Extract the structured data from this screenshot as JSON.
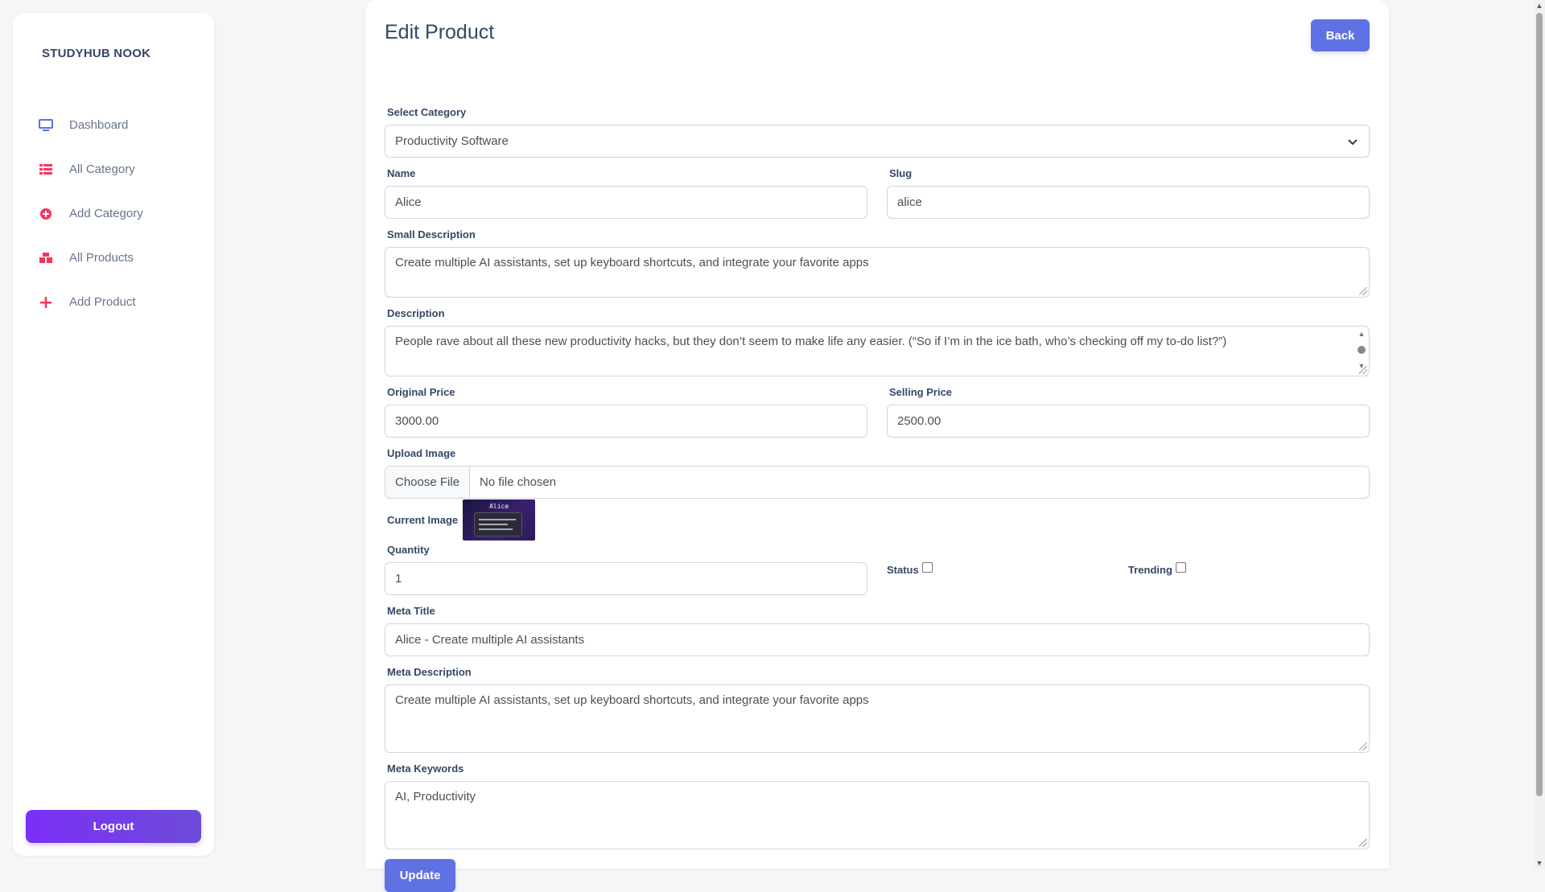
{
  "sidebar": {
    "brand": "STUDYHUB NOOK",
    "items": [
      {
        "label": "Dashboard",
        "icon": "monitor-icon"
      },
      {
        "label": "All Category",
        "icon": "list-icon"
      },
      {
        "label": "Add Category",
        "icon": "plus-circle-icon"
      },
      {
        "label": "All Products",
        "icon": "boxes-icon"
      },
      {
        "label": "Add Product",
        "icon": "plus-icon"
      }
    ],
    "logout": "Logout"
  },
  "header": {
    "title": "Edit Product",
    "back": "Back"
  },
  "form": {
    "category": {
      "label": "Select Category",
      "value": "Productivity Software"
    },
    "name": {
      "label": "Name",
      "value": "Alice"
    },
    "slug": {
      "label": "Slug",
      "value": "alice"
    },
    "small_description": {
      "label": "Small Description",
      "value": "Create multiple AI assistants, set up keyboard shortcuts, and integrate your favorite apps"
    },
    "description": {
      "label": "Description",
      "value": "People rave about all these new productivity hacks, but they don’t seem to make life any easier. (“So if I’m in the ice bath, who’s checking off my to-do list?”)"
    },
    "original_price": {
      "label": "Original Price",
      "value": "3000.00"
    },
    "selling_price": {
      "label": "Selling Price",
      "value": "2500.00"
    },
    "upload_image": {
      "label": "Upload Image",
      "button": "Choose File",
      "status": "No file chosen"
    },
    "current_image": {
      "label": "Current Image",
      "thumb_text": "Alice"
    },
    "quantity": {
      "label": "Quantity",
      "value": "1"
    },
    "status": {
      "label": "Status",
      "checked": false
    },
    "trending": {
      "label": "Trending",
      "checked": false
    },
    "meta_title": {
      "label": "Meta Title",
      "value": "Alice - Create multiple AI assistants"
    },
    "meta_description": {
      "label": "Meta Description",
      "value": "Create multiple AI assistants, set up keyboard shortcuts, and integrate your favorite apps"
    },
    "meta_keywords": {
      "label": "Meta Keywords",
      "value": "AI, Productivity"
    },
    "submit": "Update"
  },
  "colors": {
    "accent": "#5e72e4",
    "logout_gradient_start": "#7b2ff7",
    "icon_red": "#f5365c",
    "icon_blue": "#5e72e4"
  }
}
